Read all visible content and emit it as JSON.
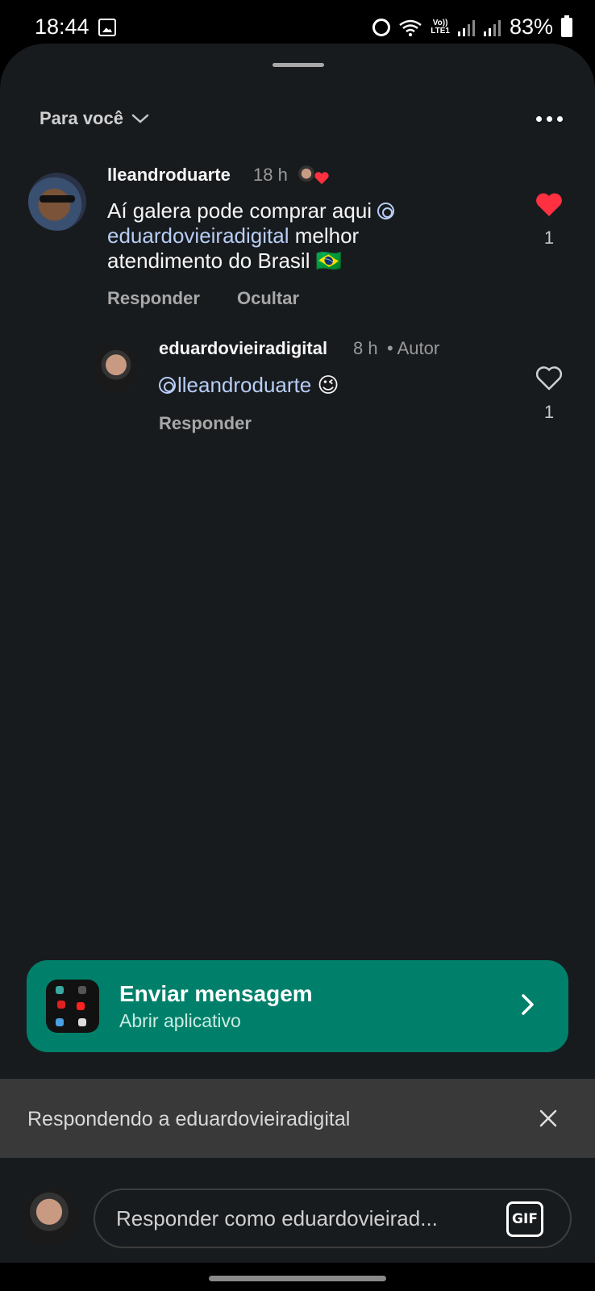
{
  "status_bar": {
    "time": "18:44",
    "network_label": "Vo))\nLTE1",
    "battery": "83%"
  },
  "sheet": {
    "filter_label": "Para você",
    "more_icon": "more-horizontal-icon"
  },
  "comments": [
    {
      "username": "lleandroduarte",
      "time": "18 h",
      "text_before": "Aí galera pode comprar aqui ",
      "mention": "eduardovieiradigital",
      "text_after": " melhor atendimento do Brasil 🇧🇷",
      "actions": [
        "Responder",
        "Ocultar"
      ],
      "likes": "1",
      "liked": true,
      "liked_by_author": true
    },
    {
      "username": "eduardovieiradigital",
      "time": "8 h",
      "badge": "• Autor",
      "mention": "lleandroduarte",
      "text_after": " 😉",
      "actions": [
        "Responder"
      ],
      "likes": "1",
      "liked": false
    }
  ],
  "cta": {
    "title": "Enviar mensagem",
    "subtitle": "Abrir aplicativo"
  },
  "replying": {
    "text": "Respondendo a eduardovieiradigital"
  },
  "composer": {
    "placeholder": "Responder como eduardovieirad...",
    "gif_label": "GIF"
  },
  "colors": {
    "sheet_bg": "#181b1e",
    "accent_green": "#00806a",
    "like_red": "#ff3040",
    "mention": "#b8cdf5"
  }
}
